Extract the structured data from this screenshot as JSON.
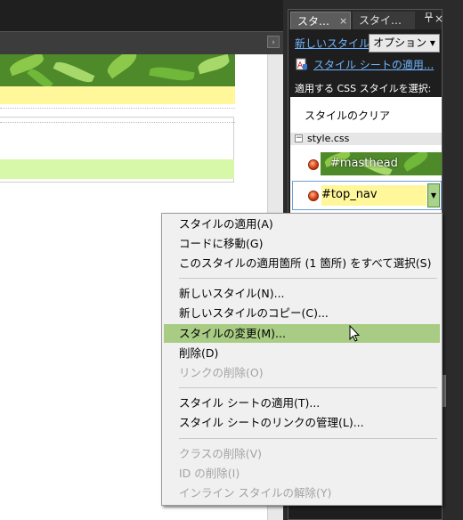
{
  "panel": {
    "tabs": [
      {
        "label": "スタ…",
        "close": "×"
      },
      {
        "label": "スタイ…"
      }
    ],
    "pin_icon": "pin-icon",
    "close_icon": "×",
    "new_style_link": "新しいスタイル...",
    "options_button": "オプション ▾",
    "attach_link": "スタイル シートの適用...",
    "select_label": "適用する CSS スタイルを選択:",
    "clear_styles": "スタイルのクリア",
    "group": {
      "collapse": "−",
      "label": "style.css"
    },
    "styles": [
      {
        "label": "#masthead"
      },
      {
        "label": "#top_nav",
        "dropdown": "▼"
      }
    ]
  },
  "editor": {
    "scroll_arrow": "›"
  },
  "context_menu": {
    "items": [
      {
        "label": "スタイルの適用(A)",
        "disabled": false
      },
      {
        "label": "コードに移動(G)",
        "disabled": false
      },
      {
        "label": "このスタイルの適用箇所 (1 箇所) をすべて選択(S)",
        "disabled": false
      },
      {
        "label": "新しいスタイル(N)...",
        "disabled": false
      },
      {
        "label": "新しいスタイルのコピー(C)...",
        "disabled": false
      },
      {
        "label": "スタイルの変更(M)...",
        "disabled": false,
        "highlighted": true
      },
      {
        "label": "削除(D)",
        "disabled": false
      },
      {
        "label": "リンクの削除(O)",
        "disabled": true
      },
      {
        "label": "スタイル シートの適用(T)...",
        "disabled": false
      },
      {
        "label": "スタイル シートのリンクの管理(L)...",
        "disabled": false
      },
      {
        "label": "クラスの削除(V)",
        "disabled": true
      },
      {
        "label": "ID の削除(I)",
        "disabled": true
      },
      {
        "label": "インライン スタイルの解除(Y)",
        "disabled": true
      }
    ]
  },
  "colors": {
    "highlight": "#a8cc84",
    "link": "#6fb5ff",
    "nav_yellow": "#fff79a",
    "footer_green": "#d7f7a9"
  }
}
